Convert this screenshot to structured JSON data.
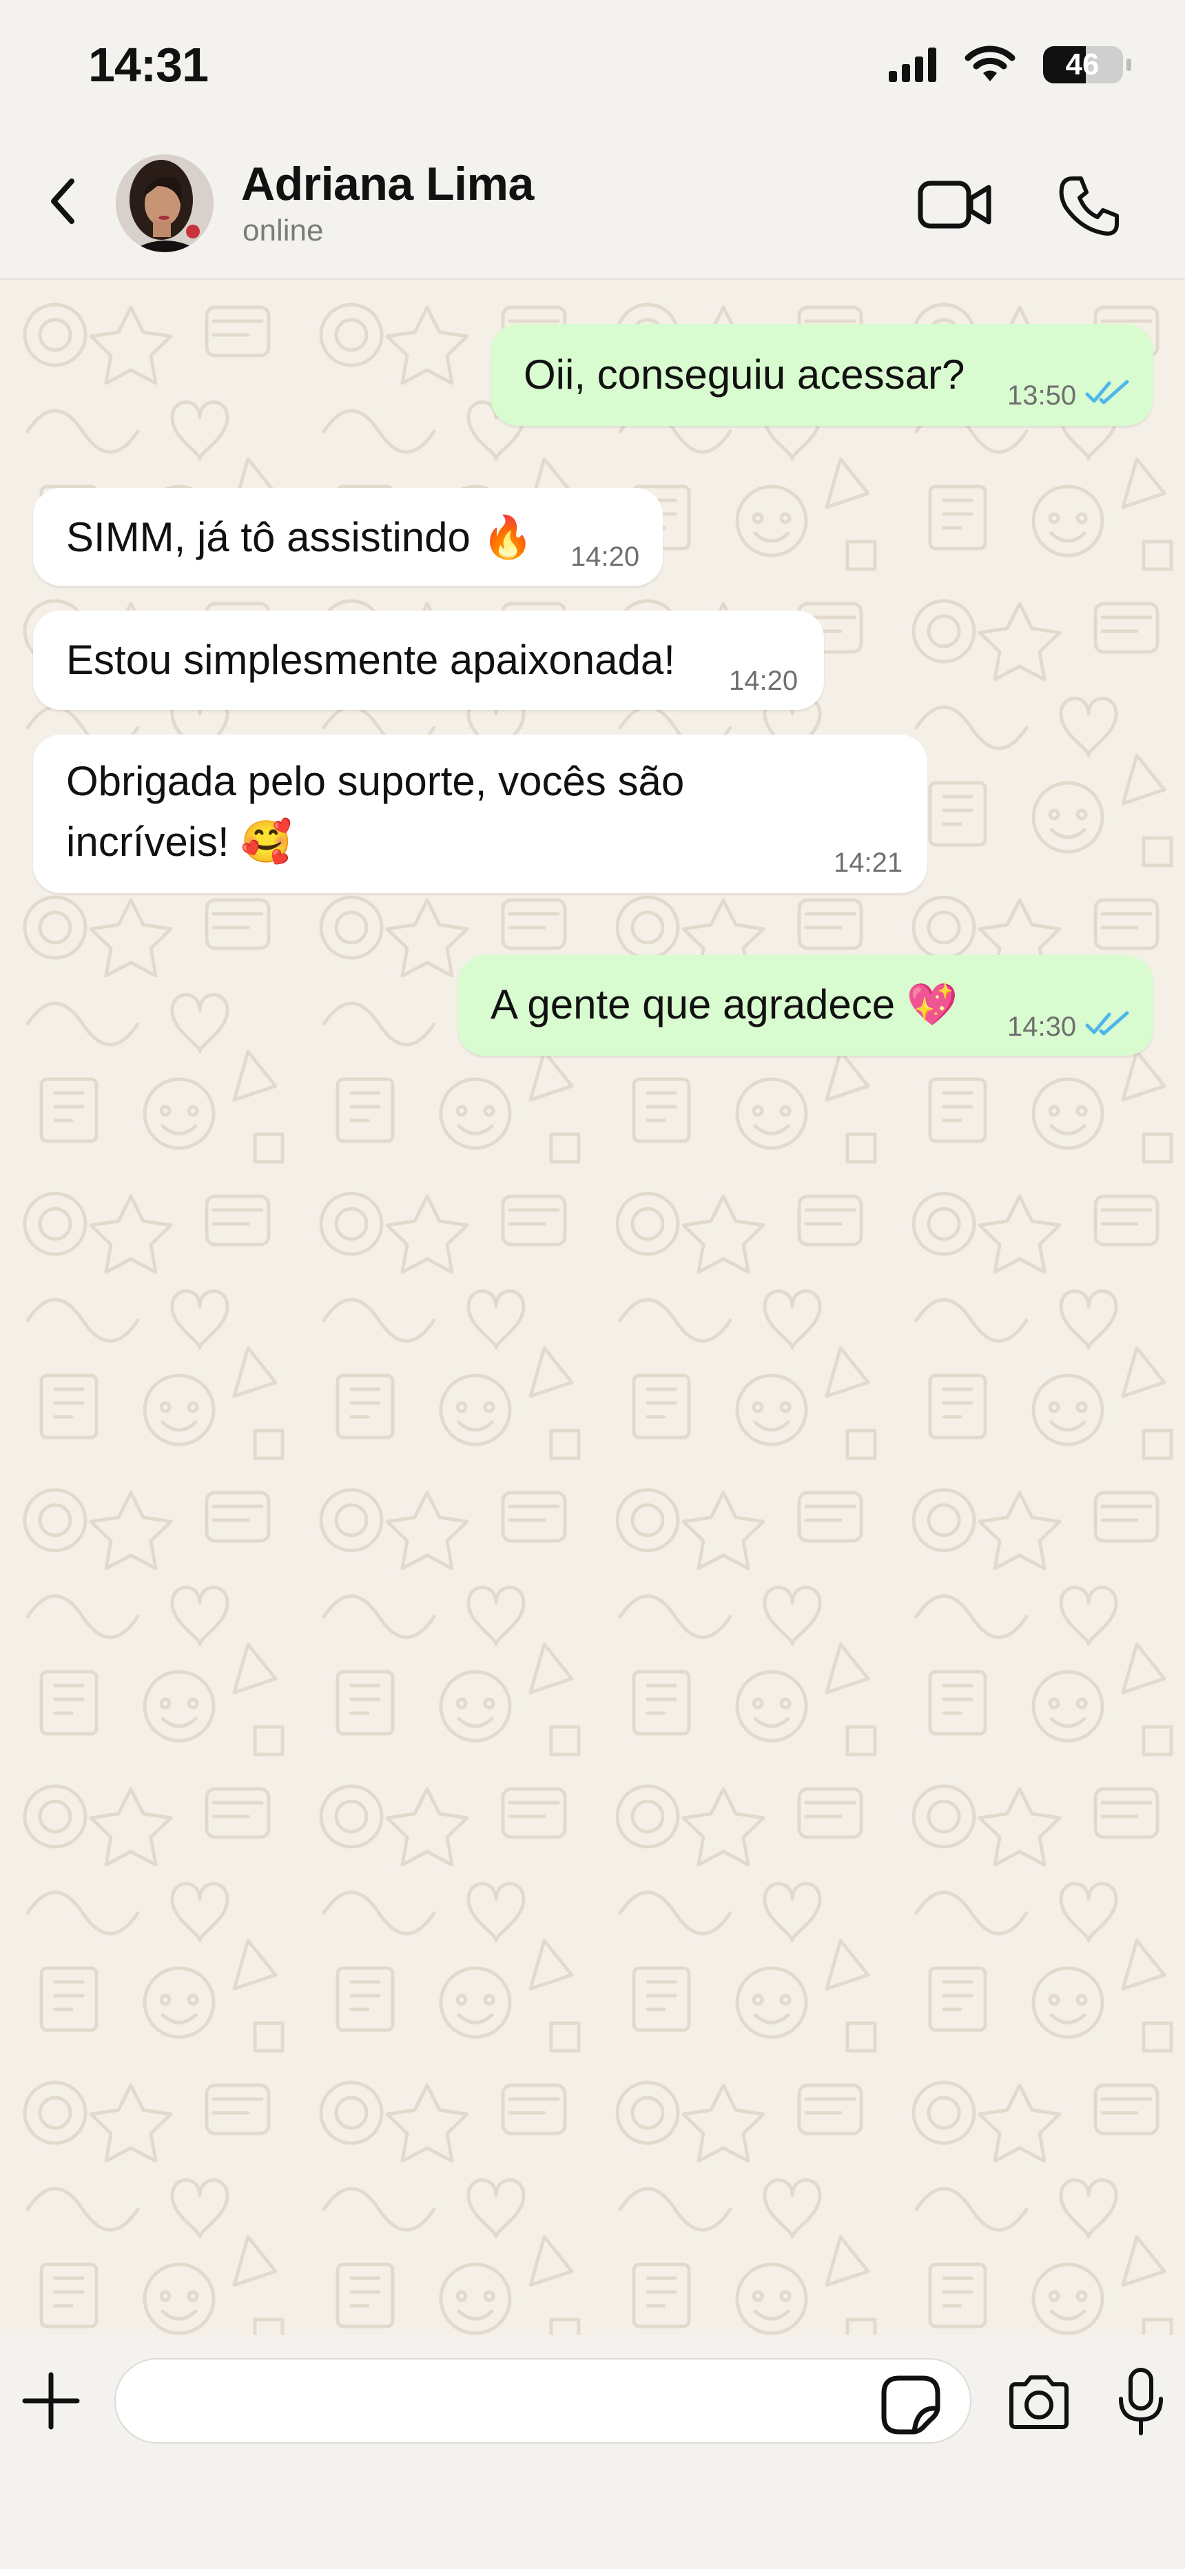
{
  "status_bar": {
    "time": "14:31",
    "battery_level": "46",
    "icons": [
      "signal-icon",
      "wifi-icon",
      "battery-icon"
    ]
  },
  "header": {
    "contact_name": "Adriana Lima",
    "contact_status": "online",
    "icons": [
      "back-chevron-icon",
      "avatar",
      "video-call-icon",
      "phone-icon"
    ]
  },
  "messages": [
    {
      "direction": "out",
      "text": "Oii, conseguiu acessar?",
      "time": "13:50",
      "status": "read"
    },
    {
      "direction": "in",
      "text": "SIMM, já tô assistindo 🔥",
      "time": "14:20"
    },
    {
      "direction": "in",
      "text": "Estou simplesmente apaixonada!",
      "time": "14:20"
    },
    {
      "direction": "in",
      "text": "Obrigada pelo suporte, vocês são\nincríveis! 🥰",
      "time": "14:21"
    },
    {
      "direction": "out",
      "text": "A gente que agradece 💖",
      "time": "14:30",
      "status": "read"
    }
  ],
  "input_bar": {
    "placeholder": "",
    "icons": [
      "plus-icon",
      "sticker-icon",
      "camera-icon",
      "microphone-icon"
    ]
  },
  "colors": {
    "outgoing_bubble": "#d8fbcf",
    "incoming_bubble": "#ffffff",
    "read_ticks": "#4fb6ec",
    "chat_background": "#f4f0e8"
  }
}
